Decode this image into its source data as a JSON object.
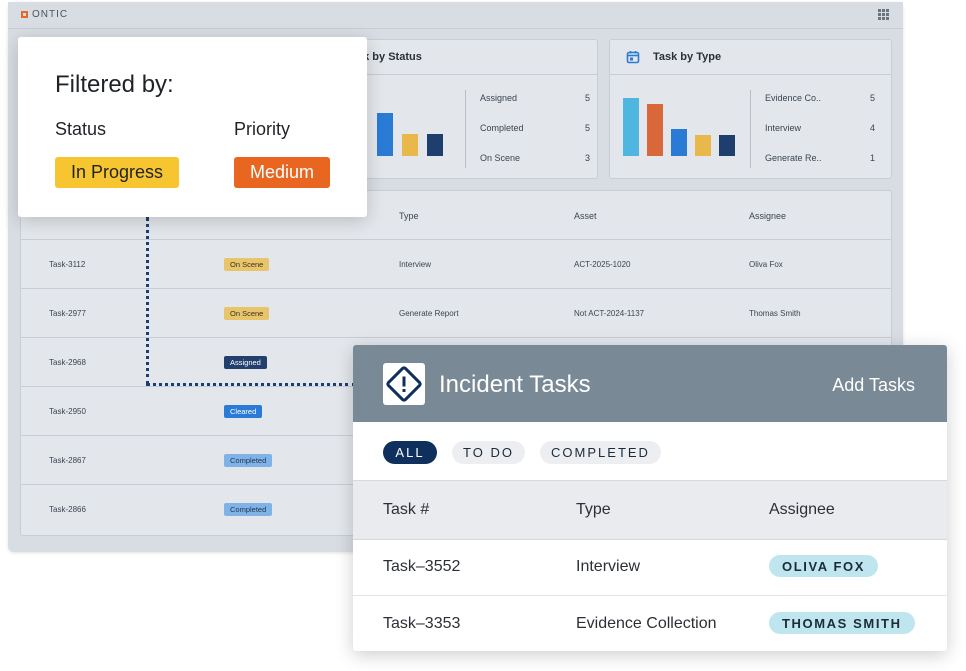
{
  "app": {
    "brand": "ONTIC"
  },
  "status_card": {
    "title": "Task by Status",
    "legend": [
      {
        "label": "Assigned",
        "value": "5"
      },
      {
        "label": "Completed",
        "value": "5"
      },
      {
        "label": "On Scene",
        "value": "3"
      }
    ]
  },
  "type_card": {
    "title": "Task by Type",
    "icon": "calendar-icon",
    "legend": [
      {
        "label": "Evidence Co..",
        "value": "5"
      },
      {
        "label": "Interview",
        "value": "4"
      },
      {
        "label": "Generate Re..",
        "value": "1"
      }
    ]
  },
  "task_table": {
    "headers": {
      "type": "Type",
      "asset": "Asset",
      "assignee": "Assignee"
    },
    "rows": [
      {
        "task": "Task-3112",
        "status": "On Scene",
        "type": "Interview",
        "asset": "ACT-2025-1020",
        "assignee": "Oliva Fox"
      },
      {
        "task": "Task-2977",
        "status": "On Scene",
        "type": "Generate Report",
        "asset": "Not ACT-2024-1137",
        "assignee": "Thomas Smith"
      },
      {
        "task": "Task-2968",
        "status": "Assigned"
      },
      {
        "task": "Task-2950",
        "status": "Cleared"
      },
      {
        "task": "Task-2867",
        "status": "Completed"
      },
      {
        "task": "Task-2866",
        "status": "Completed"
      }
    ]
  },
  "filter": {
    "title": "Filtered by:",
    "status_label": "Status",
    "status_value": "In Progress",
    "priority_label": "Priority",
    "priority_value": "Medium"
  },
  "incident_panel": {
    "title": "Incident Tasks",
    "add_label": "Add Tasks",
    "tabs": [
      "ALL",
      "TO DO",
      "COMPLETED"
    ],
    "columns": {
      "task": "Task #",
      "type": "Type",
      "assignee": "Assignee"
    },
    "rows": [
      {
        "task": "Task–3552",
        "type": "Interview",
        "assignee": "OLIVA FOX"
      },
      {
        "task": "Task–3353",
        "type": "Evidence Collection",
        "assignee": "THOMAS SMITH"
      }
    ]
  },
  "colors": {
    "in_progress": "#f7c52f",
    "medium": "#e8661f",
    "navy": "#0f2f5c",
    "pill": "#bfe6ef",
    "header": "#798995"
  }
}
